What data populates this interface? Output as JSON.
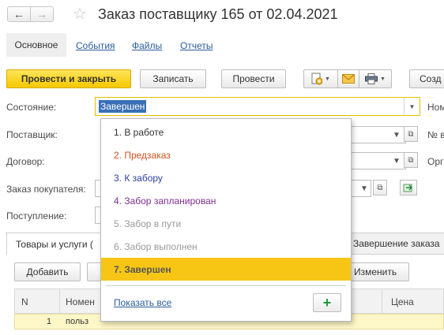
{
  "window": {
    "title": "Заказ поставщику 165  от 02.04.2021"
  },
  "tabs": {
    "main": "Основное",
    "links": [
      "События",
      "Файлы",
      "Отчеты"
    ]
  },
  "toolbar": {
    "post_close": "Провести и закрыть",
    "save": "Записать",
    "post": "Провести",
    "create_partial": "Созд"
  },
  "form": {
    "state_label": "Состояние:",
    "state_value": "Завершен",
    "supplier_label": "Поставщик:",
    "contract_label": "Договор:",
    "customer_order_label": "Заказ покупателя:",
    "receipt_label": "Поступление:",
    "right_nom": "Ном",
    "right_num": "№ в",
    "right_org": "Орг"
  },
  "state_options": [
    {
      "label": "1. В работе",
      "color": "#333333"
    },
    {
      "label": "2. Предзаказ",
      "color": "#d2501e"
    },
    {
      "label": "3. К забору",
      "color": "#2c3fa0"
    },
    {
      "label": "4. Забор запланирован",
      "color": "#7b2f8e"
    },
    {
      "label": "5. Забор в пути",
      "color": "#9a9a9a"
    },
    {
      "label": "6. Забор выполнен",
      "color": "#9a9a9a"
    },
    {
      "label": "7. Завершен",
      "color": "#555555",
      "selected": true
    }
  ],
  "popup": {
    "show_all": "Показать все"
  },
  "bottom": {
    "tab_goods": "Товары и услуги (",
    "tab_completion": "Завершение заказа",
    "add_button": "Добавить",
    "change_button": "Изменить",
    "col_n": "N",
    "col_name": "Номен",
    "col_price": "Цена",
    "row_n": "1",
    "row_name": "польз"
  },
  "colors": {
    "accent_yellow": "#f5c800",
    "selection_blue": "#3a6fb7",
    "link_blue": "#2a5d9b"
  }
}
